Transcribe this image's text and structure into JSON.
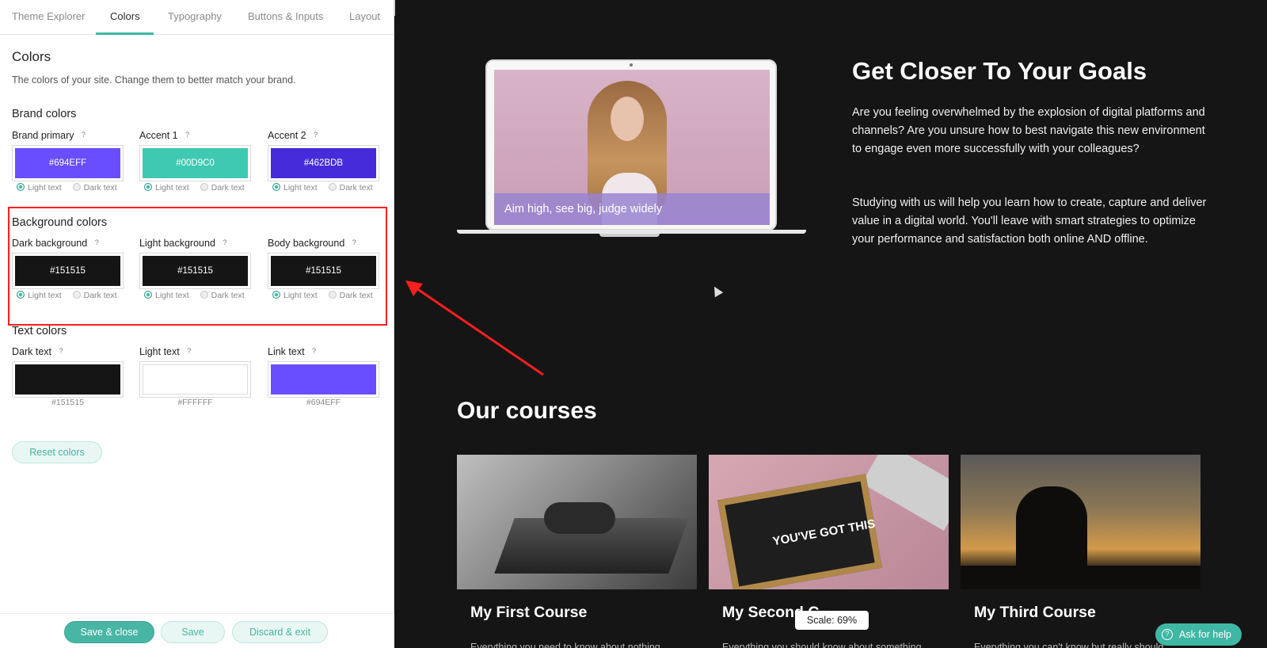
{
  "tabs": [
    "Theme Explorer",
    "Colors",
    "Typography",
    "Buttons & Inputs",
    "Layout"
  ],
  "close_label": "×",
  "colors_panel": {
    "title": "Colors",
    "description": "The colors of your site. Change them to better match your brand.",
    "help_glyph": "?",
    "radio_labels": {
      "light": "Light text",
      "dark": "Dark text"
    },
    "brand": {
      "title": "Brand colors",
      "items": [
        {
          "label": "Brand primary",
          "hex": "#694EFF",
          "text_choice": "light"
        },
        {
          "label": "Accent 1",
          "hex": "#00D9C0",
          "text_choice": "light"
        },
        {
          "label": "Accent 2",
          "hex": "#462BDB",
          "text_choice": "light"
        }
      ]
    },
    "background": {
      "title": "Background colors",
      "items": [
        {
          "label": "Dark background",
          "hex": "#151515",
          "text_choice": "light"
        },
        {
          "label": "Light background",
          "hex": "#151515",
          "text_choice": "light"
        },
        {
          "label": "Body background",
          "hex": "#151515",
          "text_choice": "light"
        }
      ]
    },
    "text": {
      "title": "Text colors",
      "items": [
        {
          "label": "Dark text",
          "hex": "#151515"
        },
        {
          "label": "Light text",
          "hex": "#FFFFFF"
        },
        {
          "label": "Link text",
          "hex": "#694EFF"
        }
      ]
    },
    "reset_label": "Reset colors"
  },
  "footer_buttons": {
    "save_close": "Save & close",
    "save": "Save",
    "discard": "Discard & exit"
  },
  "preview": {
    "hero_caption": "Aim high, see big, judge widely",
    "goals_title": "Get Closer To Your Goals",
    "goals_p1": "Are you feeling overwhelmed by the explosion of digital platforms and channels? Are you unsure how to best navigate this new environment to engage even more successfully with your colleagues?",
    "goals_p2": "Studying with us will help you learn how to create, capture and deliver value in a digital world. You'll leave with smart strategies to optimize your performance and satisfaction both online AND offline.",
    "courses_title": "Our courses",
    "courses": [
      {
        "title": "My First Course",
        "desc": "Everything you need to know about nothing"
      },
      {
        "title": "My Second C",
        "desc": "Everything you should know about something"
      },
      {
        "title": "My Third Course",
        "desc": "Everything you can't know but really should"
      }
    ],
    "board_text": "YOU'VE GOT THIS",
    "scale_label": "Scale: 69%",
    "help_button": "Ask for help"
  }
}
